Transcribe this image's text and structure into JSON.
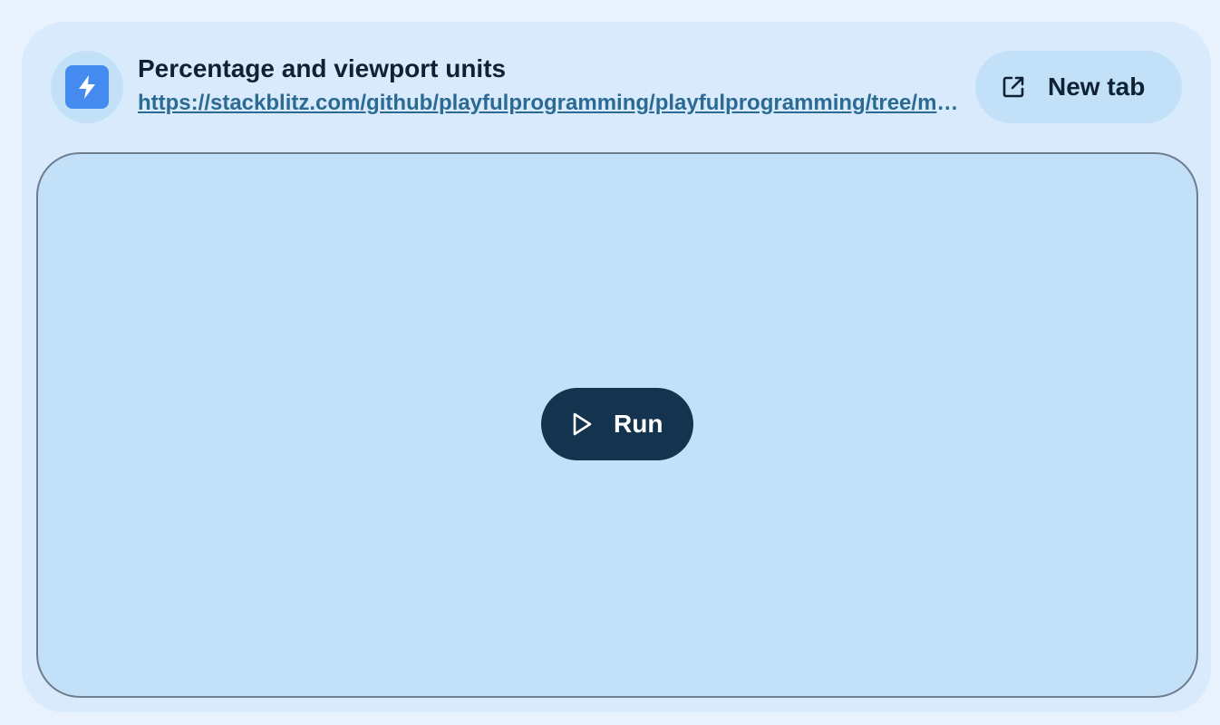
{
  "embed": {
    "title": "Percentage and viewport units",
    "url": "https://stackblitz.com/github/playfulprogramming/playfulprogramming/tree/main/content",
    "logo_icon": "lightning-bolt-icon",
    "new_tab": {
      "label": "New tab",
      "icon": "external-link-icon"
    },
    "run": {
      "label": "Run",
      "icon": "play-icon"
    }
  },
  "colors": {
    "page_background": "#e8f2fd",
    "card_background": "#d9eafc",
    "frame_background": "#c3e0f9",
    "logo_accent": "#448aef",
    "run_button": "#14334f",
    "link": "#2a6a93"
  }
}
